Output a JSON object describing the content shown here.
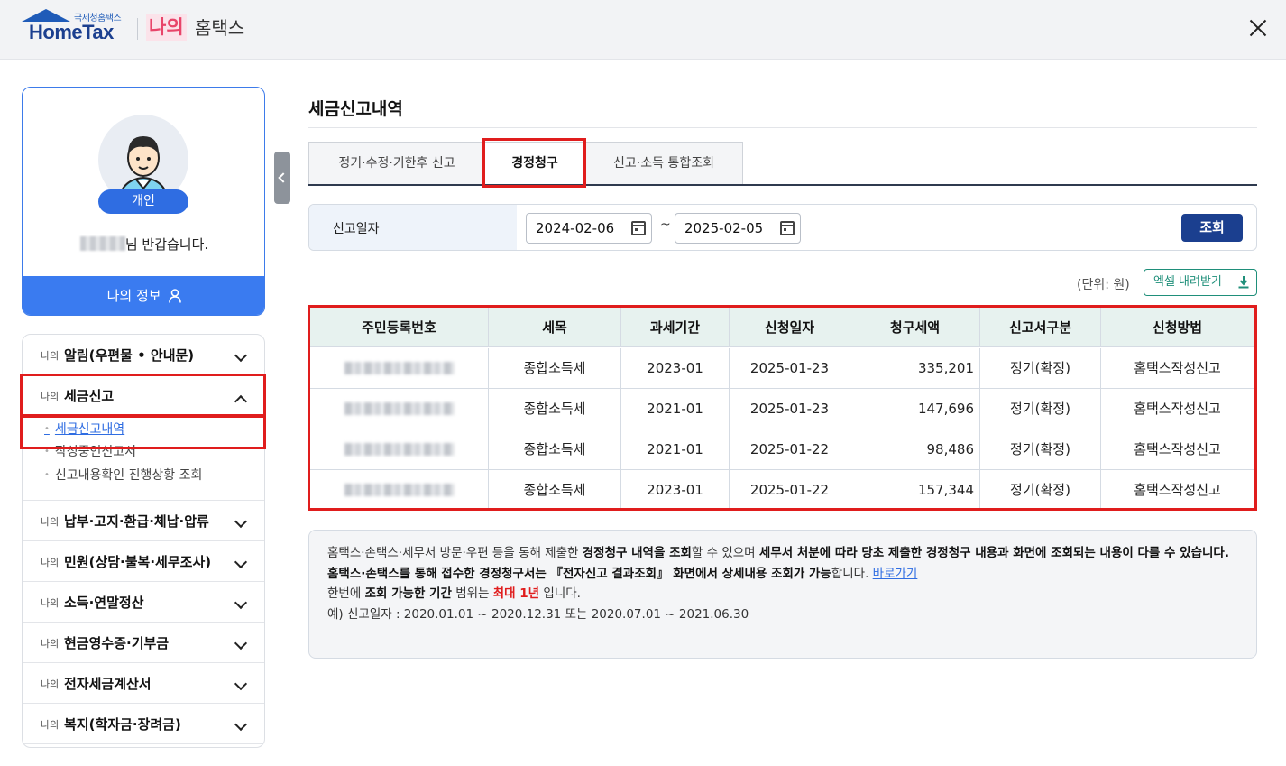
{
  "header": {
    "brand_small": "국세청홈택스",
    "brand": "HomeTax",
    "my_label": "나의",
    "hometax_label": "홈택스"
  },
  "profile": {
    "badge": "개인",
    "greeting_suffix": "님 반갑습니다.",
    "my_info_button": "나의 정보"
  },
  "sidebar": {
    "prefix": "나의",
    "items": [
      {
        "label": "알림(우편물 • 안내문)"
      },
      {
        "label": "세금신고"
      },
      {
        "label": "납부·고지·환급·체납·압류"
      },
      {
        "label": "민원(상담·불복·세무조사)"
      },
      {
        "label": "소득·연말정산"
      },
      {
        "label": "현금영수증·기부금"
      },
      {
        "label": "전자세금계산서"
      },
      {
        "label": "복지(학자금·장려금)"
      }
    ],
    "submenu": [
      {
        "label": "세금신고내역"
      },
      {
        "label": "작성중인신고서"
      },
      {
        "label": "신고내용확인 진행상황 조회"
      }
    ]
  },
  "main": {
    "title": "세금신고내역",
    "tabs": [
      {
        "label": "정기·수정·기한후 신고"
      },
      {
        "label": "경정청구"
      },
      {
        "label": "신고·소득 통합조회"
      }
    ],
    "search": {
      "label": "신고일자",
      "start_date": "2024-02-06",
      "tilde": "~",
      "end_date": "2025-02-05",
      "button": "조회"
    },
    "unit": "(단위: 원)",
    "excel_button": "엑셀 내려받기",
    "table": {
      "headers": [
        "주민등록번호",
        "세목",
        "과세기간",
        "신청일자",
        "청구세액",
        "신고서구분",
        "신청방법"
      ],
      "rows": [
        [
          "종합소득세",
          "2023-01",
          "2025-01-23",
          "335,201",
          "정기(확정)",
          "홈택스작성신고"
        ],
        [
          "종합소득세",
          "2021-01",
          "2025-01-23",
          "147,696",
          "정기(확정)",
          "홈택스작성신고"
        ],
        [
          "종합소득세",
          "2021-01",
          "2025-01-22",
          "98,486",
          "정기(확정)",
          "홈택스작성신고"
        ],
        [
          "종합소득세",
          "2023-01",
          "2025-01-22",
          "157,344",
          "정기(확정)",
          "홈택스작성신고"
        ]
      ]
    },
    "info": {
      "l1_a": "홈택스·손택스·세무서 방문·우편 등을 통해 제출한 ",
      "l1_b": "경정청구 내역을 조회",
      "l1_c": "할 수 있으며 ",
      "l1_d": "세무서 처분에 따라 당초 제출한 경정청구 내용과 화면에 조회되는 내용이 다를 수 있습니다.",
      "l2_a": "홈택스·손택스를 통해 접수한 경정청구서는 ",
      "l2_b": "『전자신고 결과조회』 화면에서 상세내용 조회가 가능",
      "l2_c": "합니다. ",
      "l2_link": "바로가기",
      "l3_a": "한번에 ",
      "l3_b": "조회 가능한 기간",
      "l3_c": " 범위는 ",
      "l3_red": "최대 1년",
      "l3_d": " 입니다.",
      "l4": "예) 신고일자 : 2020.01.01 ~ 2020.12.31 또는 2020.07.01 ~ 2021.06.30"
    }
  },
  "colors": {
    "accent": "#3a7bf0",
    "navy": "#1b3f8f",
    "highlight_red": "#e01d1d",
    "table_head": "#e7f2ef"
  }
}
